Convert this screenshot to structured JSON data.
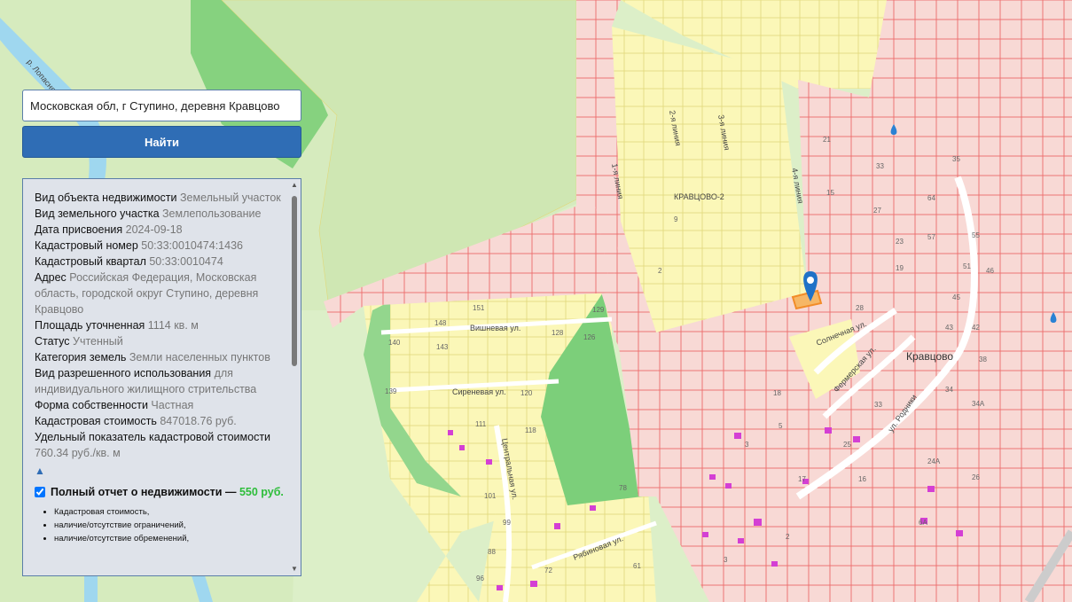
{
  "search": {
    "value": "Московская обл, г Ступино, деревня Кравцово",
    "button_label": "Найти"
  },
  "info": {
    "rows": [
      {
        "key": "Вид объекта недвижимости",
        "value": "Земельный участок"
      },
      {
        "key": "Вид земельного участка",
        "value": "Землепользование"
      },
      {
        "key": "Дата присвоения",
        "value": "2024-09-18"
      },
      {
        "key": "Кадастровый номер",
        "value": "50:33:0010474:1436"
      },
      {
        "key": "Кадастровый квартал",
        "value": "50:33:0010474"
      },
      {
        "key": "Адрес",
        "value": "Российская Федерация, Московская область, городской округ Ступино, деревня Кравцово"
      },
      {
        "key": "Площадь уточненная",
        "value": "1114 кв. м"
      },
      {
        "key": "Статус",
        "value": "Учтенный"
      },
      {
        "key": "Категория земель",
        "value": "Земли населенных пунктов"
      },
      {
        "key": "Вид разрешенного использования",
        "value": "для индивидуального жилищного стрительства"
      },
      {
        "key": "Форма собственности",
        "value": "Частная"
      },
      {
        "key": "Кадастровая стоимость",
        "value": "847018.76 руб."
      },
      {
        "key": "Удельный показатель кадастровой стоимости",
        "value": "760.34 руб./кв. м"
      }
    ],
    "collapse_icon": "▲",
    "report_label": "Полный отчет о недвижимости —",
    "report_price": "550 руб.",
    "report_items": [
      "Кадастровая стоимость,",
      "наличие/отсутствие ограничений,",
      "наличие/отсутствие обременений,"
    ]
  },
  "map": {
    "labels": {
      "river": "р. Лопасня",
      "area": "КРАВЦОВО-2",
      "village": "Кравцово",
      "vishnevaya": "Вишневая ул.",
      "sirenevaya": "Сиреневая ул.",
      "tsentralnaya": "Центральная ул.",
      "ryabinovaya": "Рябиновая ул.",
      "solnechnaya": "Солнечная ул.",
      "fermerskaya": "Фермерская ул.",
      "rodniki": "ул. Родники",
      "line1": "1-я линия",
      "line2": "2-я линия",
      "line3": "3-я линия",
      "line4": "4-я линия"
    },
    "numbers": [
      {
        "t": "151"
      },
      {
        "t": "148"
      },
      {
        "t": "129"
      },
      {
        "t": "140"
      },
      {
        "t": "143"
      },
      {
        "t": "128"
      },
      {
        "t": "126"
      },
      {
        "t": "139"
      },
      {
        "t": "120"
      },
      {
        "t": "111"
      },
      {
        "t": "118"
      },
      {
        "t": "101"
      },
      {
        "t": "99"
      },
      {
        "t": "88"
      },
      {
        "t": "78"
      },
      {
        "t": "72"
      },
      {
        "t": "61"
      },
      {
        "t": "96"
      },
      {
        "t": "9"
      },
      {
        "t": "2"
      },
      {
        "t": "21"
      },
      {
        "t": "33"
      },
      {
        "t": "15"
      },
      {
        "t": "27"
      },
      {
        "t": "23"
      },
      {
        "t": "19"
      },
      {
        "t": "28"
      },
      {
        "t": "57"
      },
      {
        "t": "55"
      },
      {
        "t": "51"
      },
      {
        "t": "46"
      },
      {
        "t": "45"
      },
      {
        "t": "43"
      },
      {
        "t": "42"
      },
      {
        "t": "38"
      },
      {
        "t": "34"
      },
      {
        "t": "34А"
      },
      {
        "t": "24А"
      },
      {
        "t": "26"
      },
      {
        "t": "16"
      },
      {
        "t": "18"
      },
      {
        "t": "5"
      },
      {
        "t": "3"
      },
      {
        "t": "17"
      },
      {
        "t": "25"
      },
      {
        "t": "33"
      },
      {
        "t": "2"
      },
      {
        "t": "3"
      },
      {
        "t": "6А"
      },
      {
        "t": "64"
      },
      {
        "t": "35"
      }
    ],
    "colors": {
      "parcel_fill": "#f8d9d5",
      "parcel_stroke": "#ec6a6a",
      "settlement_fill": "#fbf7b8",
      "forest": "#cfe7b3",
      "park_green": "#7ccf7a",
      "river": "#9fd7ef",
      "selected_parcel": "#f28c28",
      "pin": "#1f72c7",
      "building": "#d43fd4"
    }
  }
}
